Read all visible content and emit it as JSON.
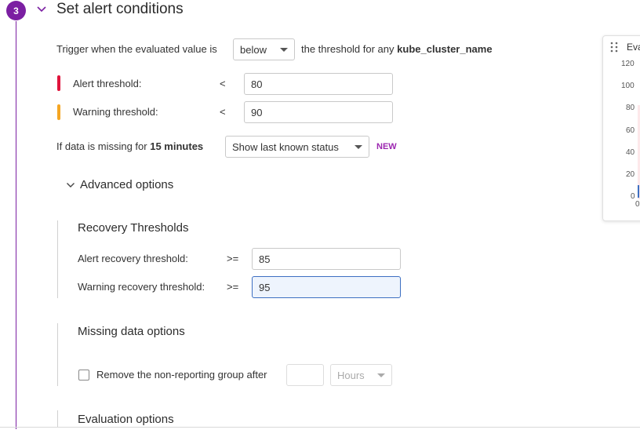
{
  "step": {
    "number": "3",
    "title": "Set alert conditions"
  },
  "trigger": {
    "prefix": "Trigger when the evaluated value is",
    "comparator": "below",
    "suffix": "the threshold for any",
    "group_by": "kube_cluster_name"
  },
  "alert_threshold": {
    "label": "Alert threshold:",
    "operator": "<",
    "value": "80",
    "color": "#e0143c"
  },
  "warning_threshold": {
    "label": "Warning threshold:",
    "operator": "<",
    "value": "90",
    "color": "#f5a623"
  },
  "missing_data": {
    "prefix": "If data is missing for",
    "duration": "15 minutes",
    "option": "Show last known status",
    "badge": "NEW"
  },
  "advanced": {
    "toggle_label": "Advanced options"
  },
  "recovery": {
    "title": "Recovery Thresholds",
    "alert_label": "Alert recovery threshold:",
    "alert_operator": ">=",
    "alert_value": "85",
    "warning_label": "Warning recovery threshold:",
    "warning_operator": ">=",
    "warning_value": "95"
  },
  "missing_data_options": {
    "title": "Missing data options",
    "checkbox_label": "Remove the non-reporting group after",
    "duration_value": "",
    "unit": "Hours"
  },
  "evaluation": {
    "title": "Evaluation options"
  },
  "preview_panel": {
    "title": "Eva",
    "y_ticks": [
      "120",
      "100",
      "80",
      "60",
      "40",
      "20",
      "0"
    ],
    "x_tick": "0"
  }
}
